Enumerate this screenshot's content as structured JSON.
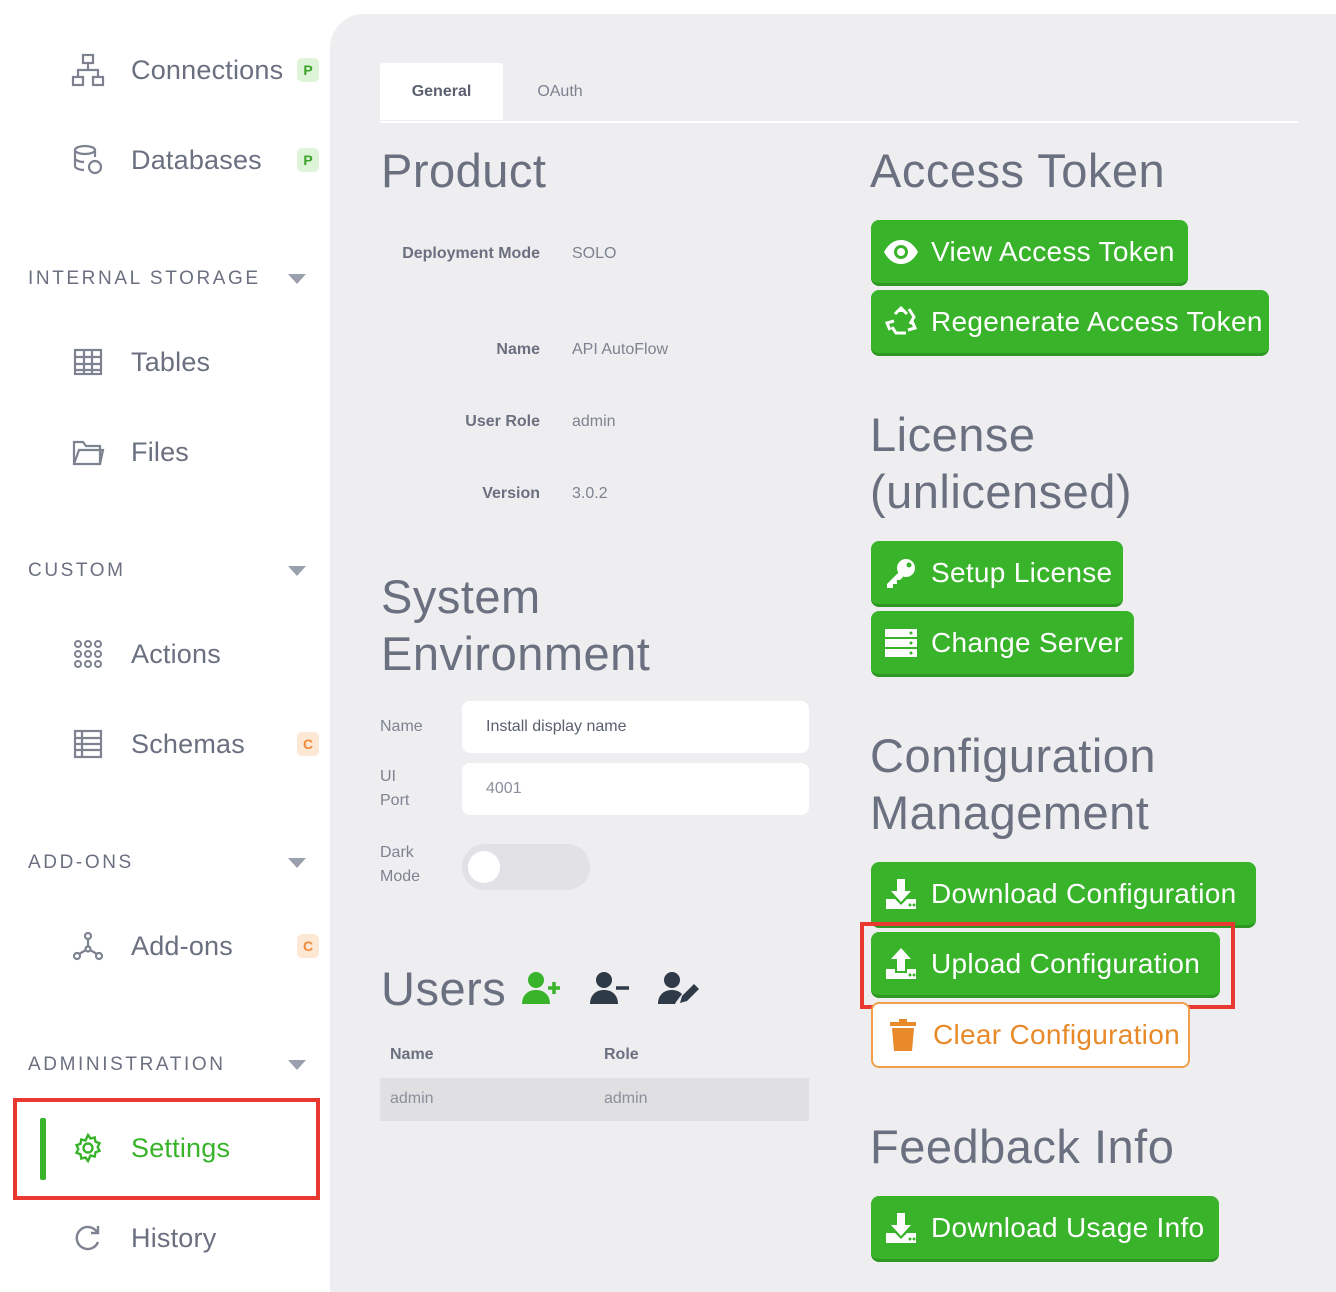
{
  "sidebar": {
    "items": [
      {
        "label": "Connections",
        "icon": "sitemap-icon",
        "badge": "P"
      },
      {
        "label": "Databases",
        "icon": "database-icon",
        "badge": "P"
      },
      {
        "label": "Tables",
        "icon": "table-icon"
      },
      {
        "label": "Files",
        "icon": "folder-icon"
      },
      {
        "label": "Actions",
        "icon": "actions-grid-icon"
      },
      {
        "label": "Schemas",
        "icon": "schema-icon",
        "badge": "C"
      },
      {
        "label": "Add-ons",
        "icon": "addons-icon",
        "badge": "C"
      },
      {
        "label": "Settings",
        "icon": "gear-icon"
      },
      {
        "label": "History",
        "icon": "refresh-icon"
      }
    ],
    "sections": [
      "INTERNAL STORAGE",
      "CUSTOM",
      "ADD-ONS",
      "ADMINISTRATION"
    ]
  },
  "tabs": [
    "General",
    "OAuth"
  ],
  "product": {
    "title": "Product",
    "fields": [
      {
        "key": "Deployment Mode",
        "value": "SOLO"
      },
      {
        "key": "Name",
        "value": "API AutoFlow"
      },
      {
        "key": "User Role",
        "value": "admin"
      },
      {
        "key": "Version",
        "value": "3.0.2"
      }
    ]
  },
  "system": {
    "title_1": "System",
    "title_2": "Environment",
    "name_label": "Name",
    "name_placeholder": "Install display name",
    "port_label_1": "UI",
    "port_label_2": "Port",
    "port_value": "4001",
    "dark_label_1": "Dark",
    "dark_label_2": "Mode",
    "dark_mode": false
  },
  "users": {
    "title": "Users",
    "columns": [
      "Name",
      "Role"
    ],
    "rows": [
      {
        "name": "admin",
        "role": "admin"
      }
    ]
  },
  "access_token": {
    "title": "Access Token",
    "view_label": "View Access Token",
    "regen_label": "Regenerate Access Token"
  },
  "license": {
    "title_1": "License",
    "title_2": "(unlicensed)",
    "setup_label": "Setup License",
    "server_label": "Change Server"
  },
  "config": {
    "title_1": "Configuration",
    "title_2": "Management",
    "download_label": "Download Configuration",
    "upload_label": "Upload Configuration",
    "clear_label": "Clear Configuration"
  },
  "feedback": {
    "title": "Feedback Info",
    "download_label": "Download Usage Info"
  },
  "colors": {
    "accent": "#38b32a",
    "warning": "#e88a2a",
    "highlight": "#e8382f"
  }
}
